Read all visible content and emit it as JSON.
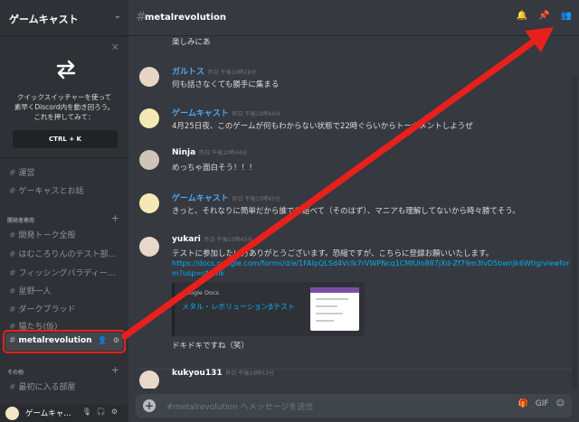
{
  "server": {
    "name": "ゲームキャスト"
  },
  "switcher": {
    "text_line1": "クイックスイッチャーを使って",
    "text_line2": "素早くDiscord内を動き回ろう。",
    "text_line3": "これを押してみて：",
    "shortcut": "CTRL + K"
  },
  "channels": {
    "top": [
      "運営",
      "ゲーキャスとお話"
    ],
    "category_dev": "開発者専用",
    "dev": [
      "開発トーク全般",
      "はむころりんのテスト部…",
      "フィッシングパラディー…",
      "星野一人",
      "ダークブラッド",
      "猫たち(仮)"
    ],
    "active": "metalrevolution",
    "category_other": "その他",
    "other": [
      "最初に入る部屋"
    ]
  },
  "user": {
    "name": "ゲームキャ…"
  },
  "topbar": {
    "channel": "metalrevolution"
  },
  "messages": [
    {
      "text": "楽しみにあ"
    },
    {
      "author": "ガルトス",
      "author_color": "#4da8f0",
      "time": "昨日 午後10時28分",
      "text": "何も話さなくても勝手に集まる"
    },
    {
      "author": "ゲームキャスト",
      "author_color": "#4da8f0",
      "time": "昨日 午後10時44分",
      "text": "4月25日夜、このゲームが何もわからない状態で22時ぐらいからトーナメントしようぜ"
    },
    {
      "author": "Ninja",
      "author_color": "#ffffff",
      "time": "昨日 午後10時44分",
      "text": "めっちゃ面白そう！！！"
    },
    {
      "author": "ゲームキャスト",
      "author_color": "#4da8f0",
      "time": "昨日 午後10時45分",
      "text": "きっと、それなりに簡単だから誰でも遊べて（そのはず）、マニアも理解してないから時々勝てそう。"
    },
    {
      "author": "yukari",
      "author_color": "#ffffff",
      "time": "昨日 午後10時45分",
      "text": "テストに参加したい方ありがとうございます。恐縮ですが、こちらに登録お願いいたします。",
      "link": "https://docs.google.com/forms/d/e/1FAIpQLSd4Vclk7rVWPNcq1CMIUlo887jXd-Zf79m3lvD5bwnJk6Wtig/viewform?usp=sf_link",
      "embed_provider": "Google Docs",
      "embed_title": "メタル・レボリューションβテスト",
      "followup": "ドキドキですね（笑）"
    },
    {
      "author": "kukyou131",
      "author_color": "#ffffff",
      "time": "昨日 午後10時53分"
    }
  ],
  "input": {
    "placeholder": "#metalrevolution へメッセージを送信"
  },
  "colors": {
    "accent_red": "#e8201c",
    "link": "#00b0f4",
    "background": "#36393f",
    "sidebar": "#2f3136"
  }
}
